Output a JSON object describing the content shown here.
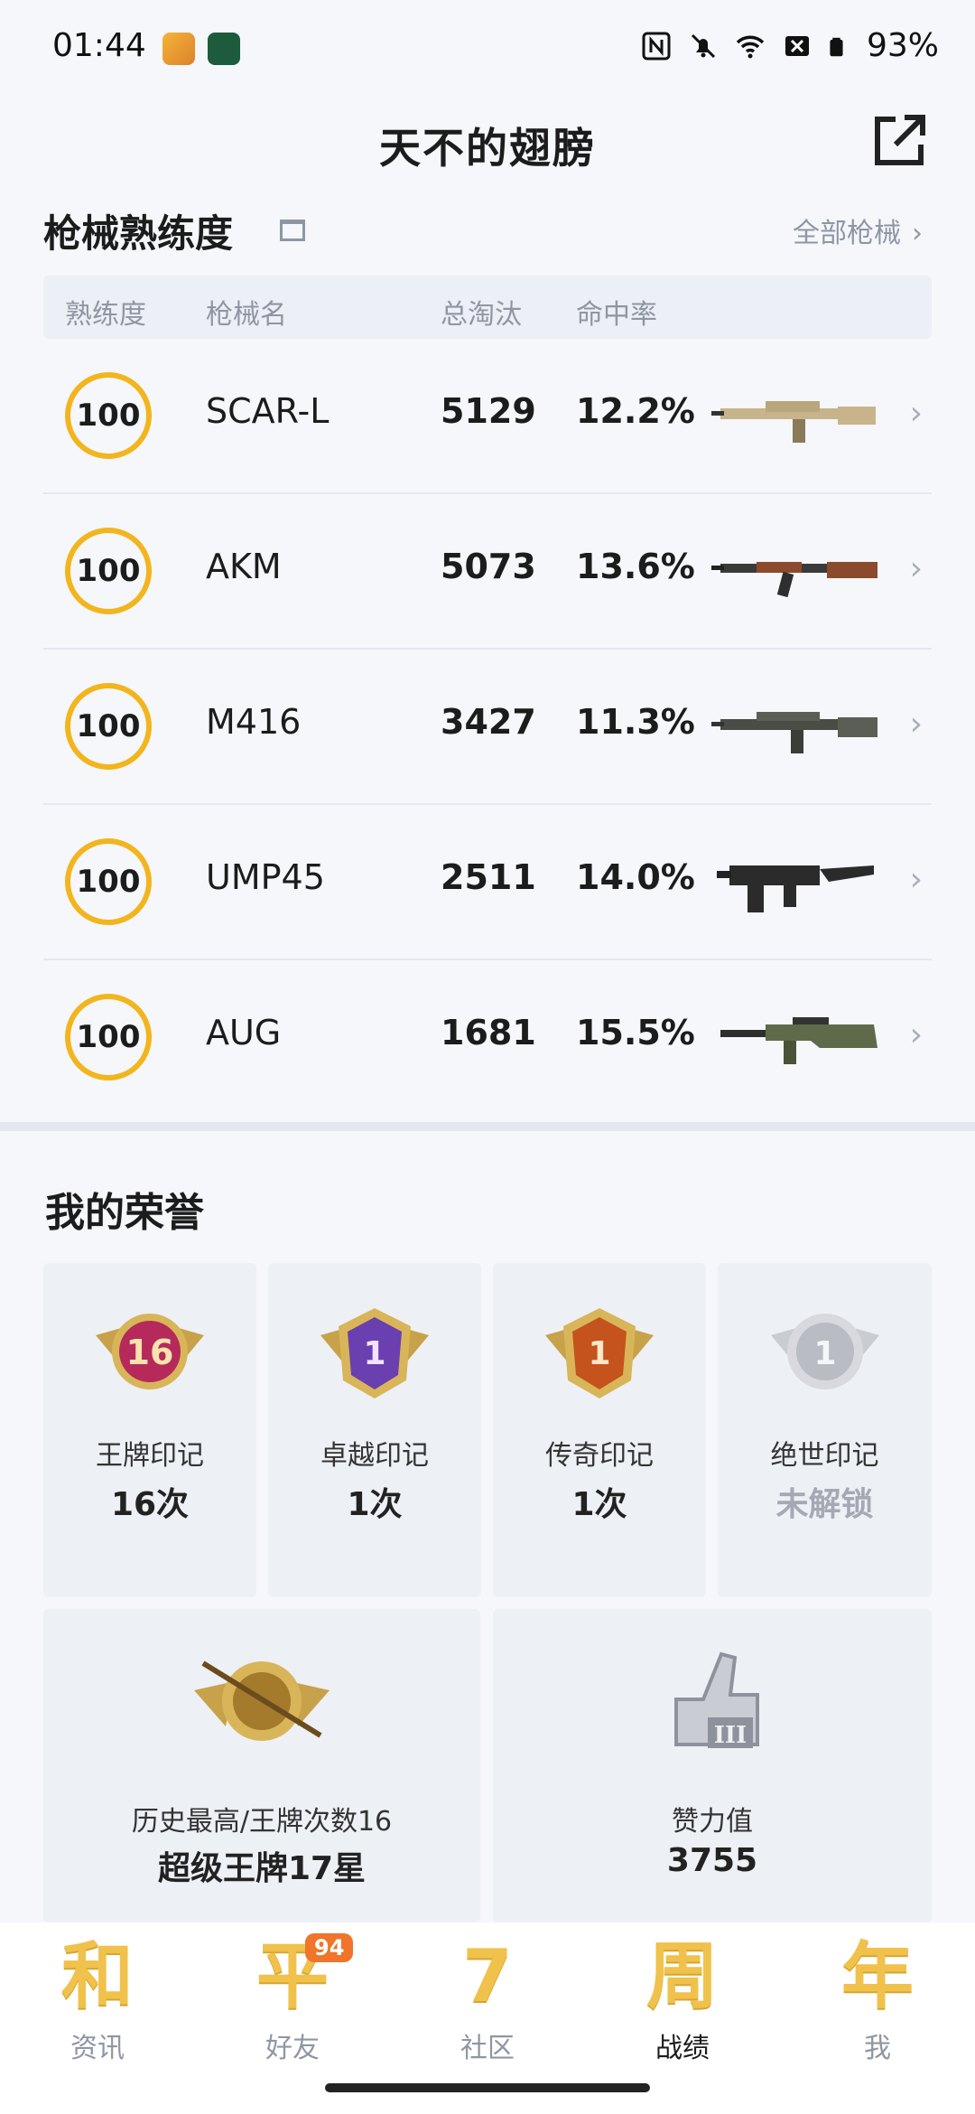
{
  "status_bar": {
    "time": "01:44",
    "battery": "93%"
  },
  "header": {
    "title": "天不的翅膀"
  },
  "weapons": {
    "section_title": "枪械熟练度",
    "all_link": "全部枪械",
    "columns": [
      "熟练度",
      "枪械名",
      "总淘汰",
      "命中率"
    ],
    "rows": [
      {
        "proficiency": "100",
        "name": "SCAR-L",
        "eliminations": "5129",
        "hit_rate": "12.2%"
      },
      {
        "proficiency": "100",
        "name": "AKM",
        "eliminations": "5073",
        "hit_rate": "13.6%"
      },
      {
        "proficiency": "100",
        "name": "M416",
        "eliminations": "3427",
        "hit_rate": "11.3%"
      },
      {
        "proficiency": "100",
        "name": "UMP45",
        "eliminations": "2511",
        "hit_rate": "14.0%"
      },
      {
        "proficiency": "100",
        "name": "AUG",
        "eliminations": "1681",
        "hit_rate": "15.5%"
      }
    ]
  },
  "honors": {
    "title": "我的荣誉",
    "marks": [
      {
        "label": "王牌印记",
        "value": "16次",
        "medal_number": "16",
        "color": "#b52a5a"
      },
      {
        "label": "卓越印记",
        "value": "1次",
        "medal_number": "1",
        "color": "#6a3fb0"
      },
      {
        "label": "传奇印记",
        "value": "1次",
        "medal_number": "1",
        "color": "#c4531e"
      },
      {
        "label": "绝世印记",
        "value": "未解锁",
        "medal_number": "1",
        "color": "#b9bcc2"
      }
    ],
    "big": [
      {
        "label": "历史最高/王牌次数16",
        "value": "超级王牌17星"
      },
      {
        "label": "赞力值",
        "value": "3755"
      }
    ]
  },
  "tabbar": {
    "items": [
      {
        "glyph": "和",
        "label": "资讯"
      },
      {
        "glyph": "平",
        "label": "好友",
        "badge": "94"
      },
      {
        "glyph": "7",
        "label": "社区"
      },
      {
        "glyph": "周",
        "label": "战绩"
      },
      {
        "glyph": "年",
        "label": "我"
      }
    ],
    "active": "战绩"
  }
}
